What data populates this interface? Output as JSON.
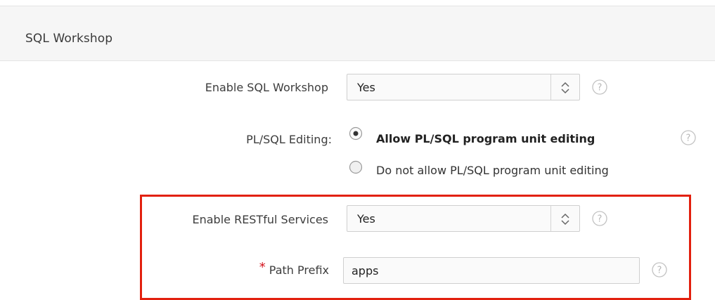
{
  "section": {
    "title": "SQL Workshop"
  },
  "enable_sql_workshop": {
    "label": "Enable SQL Workshop",
    "value": "Yes"
  },
  "plsql_editing": {
    "label": "PL/SQL Editing:",
    "options": [
      {
        "label": "Allow PL/SQL program unit editing",
        "selected": true
      },
      {
        "label": "Do not allow PL/SQL program unit editing",
        "selected": false
      }
    ]
  },
  "enable_restful": {
    "label": "Enable RESTful Services",
    "value": "Yes"
  },
  "path_prefix": {
    "label": "Path Prefix",
    "required_marker": "*",
    "value": "apps"
  },
  "icons": {
    "help": "help-icon",
    "select_arrows": "updown-chevron-icon",
    "radio": "radio-icon"
  },
  "colors": {
    "highlight": "#e2200e",
    "required": "#d3121c",
    "header_bg": "#f6f6f6"
  }
}
